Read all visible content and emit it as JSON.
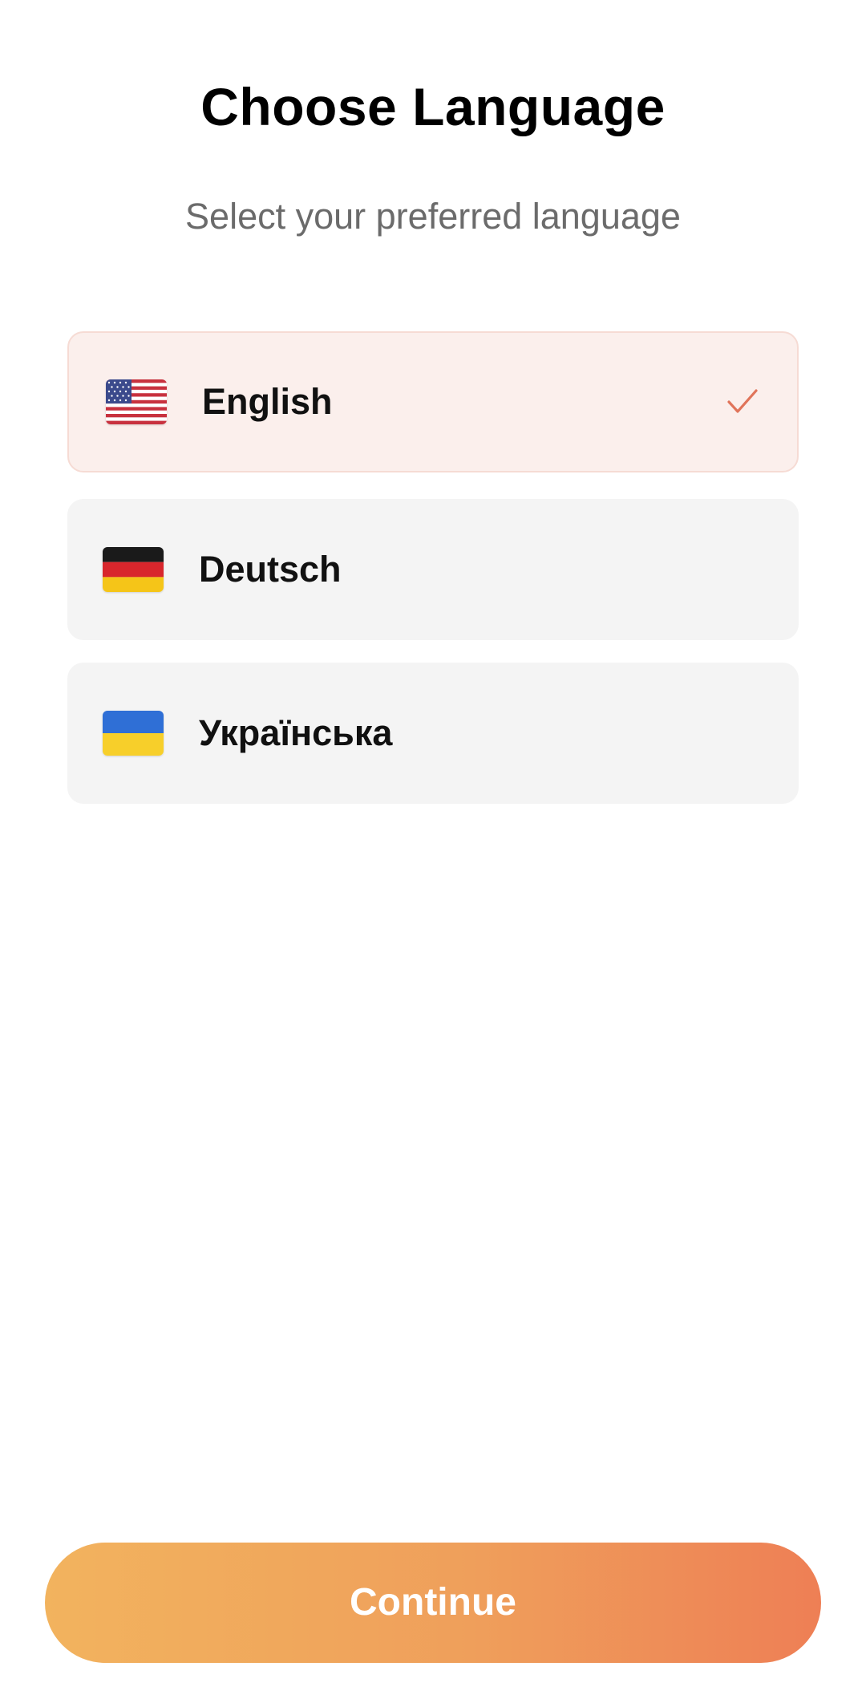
{
  "header": {
    "title": "Choose Language",
    "subtitle": "Select your preferred language"
  },
  "languages": [
    {
      "label": "English",
      "flag": "us-flag-icon",
      "selected": true
    },
    {
      "label": "Deutsch",
      "flag": "germany-flag-icon",
      "selected": false
    },
    {
      "label": "Українська",
      "flag": "ukraine-flag-icon",
      "selected": false
    }
  ],
  "selection_icon": "checkmark-icon",
  "footer": {
    "continue_label": "Continue"
  },
  "colors": {
    "selected_bg": "#fbefec",
    "selected_border": "#f6dbd4",
    "option_bg": "#f4f4f4",
    "accent": "#e0745a",
    "button_gradient_start": "#f2b35e",
    "button_gradient_end": "#ee7f55"
  }
}
